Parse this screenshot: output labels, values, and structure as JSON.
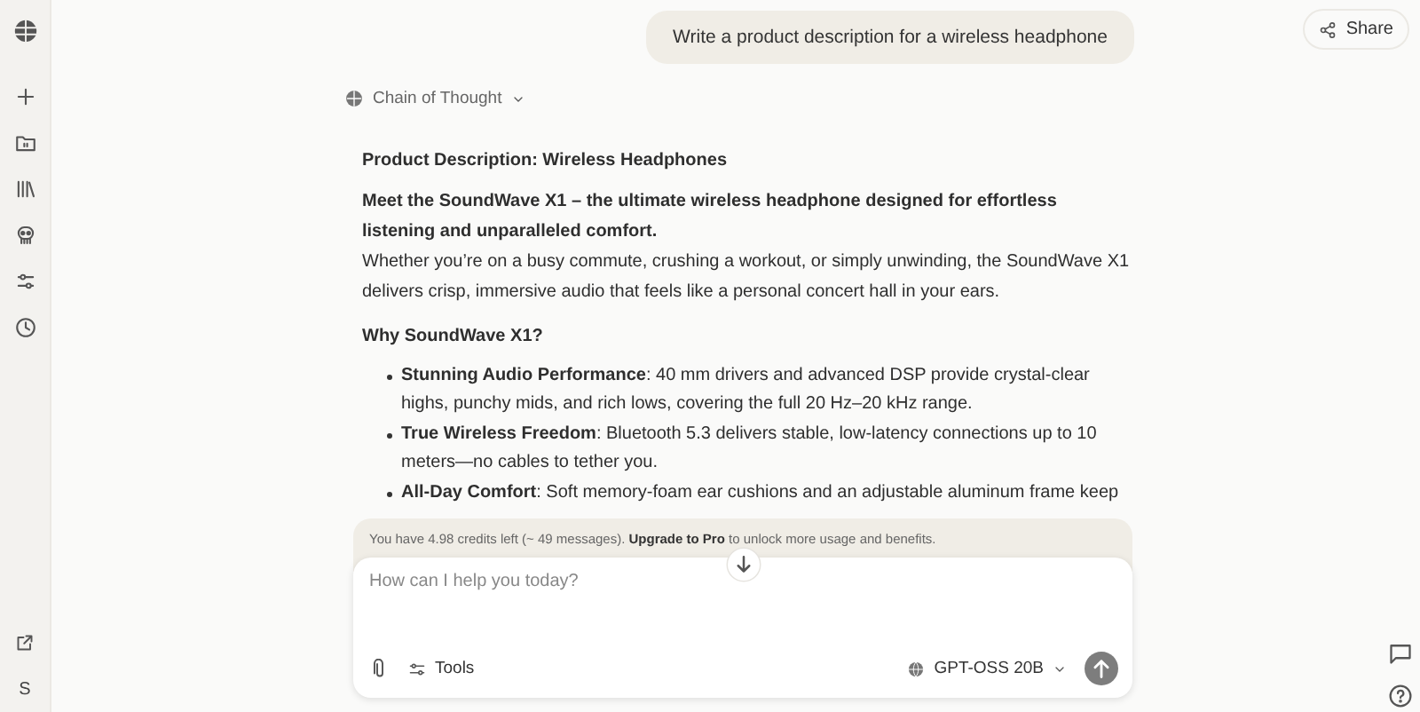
{
  "sidebar": {
    "avatar": "S"
  },
  "header": {
    "share_label": "Share"
  },
  "user_message": "Write a product description for a wireless headphone",
  "chain_of_thought": {
    "label": "Chain of Thought",
    "expanded": false
  },
  "response": [
    {
      "kind": "heading",
      "text": "Product Description: Wireless Headphones"
    },
    {
      "kind": "lead",
      "text": "Meet the SoundWave X1 – the ultimate wireless headphone designed for effortless listening and unparalleled comfort."
    },
    {
      "kind": "paragraph",
      "text": "Whether you’re on a busy commute, crushing a workout, or simply unwinding, the SoundWave X1 delivers crisp, immersive audio that feels like a personal concert hall in your ears."
    },
    {
      "kind": "heading",
      "text": "Why SoundWave X1?"
    },
    {
      "kind": "list",
      "items": [
        "**Stunning Audio Performance**: 40 mm drivers and advanced DSP provide crystal‑clear highs, punchy mids, and rich lows, covering the full 20 Hz–20 kHz range.",
        "**True Wireless Freedom**: Bluetooth 5.3 delivers stable, low‑latency connections up to 10 meters—no cables to tether you.",
        "**All‑Day Comfort**: Soft memory‑foam ear cushions and an adjustable aluminum frame keep"
      ]
    }
  ],
  "notice": {
    "before": "You have 4.98 credits left (~ 49 messages). ",
    "link": "Upgrade to Pro",
    "after": " to unlock more usage and benefits."
  },
  "composer": {
    "placeholder": "How can I help you today?",
    "tools_label": "Tools",
    "model": "GPT-OSS 20B"
  }
}
